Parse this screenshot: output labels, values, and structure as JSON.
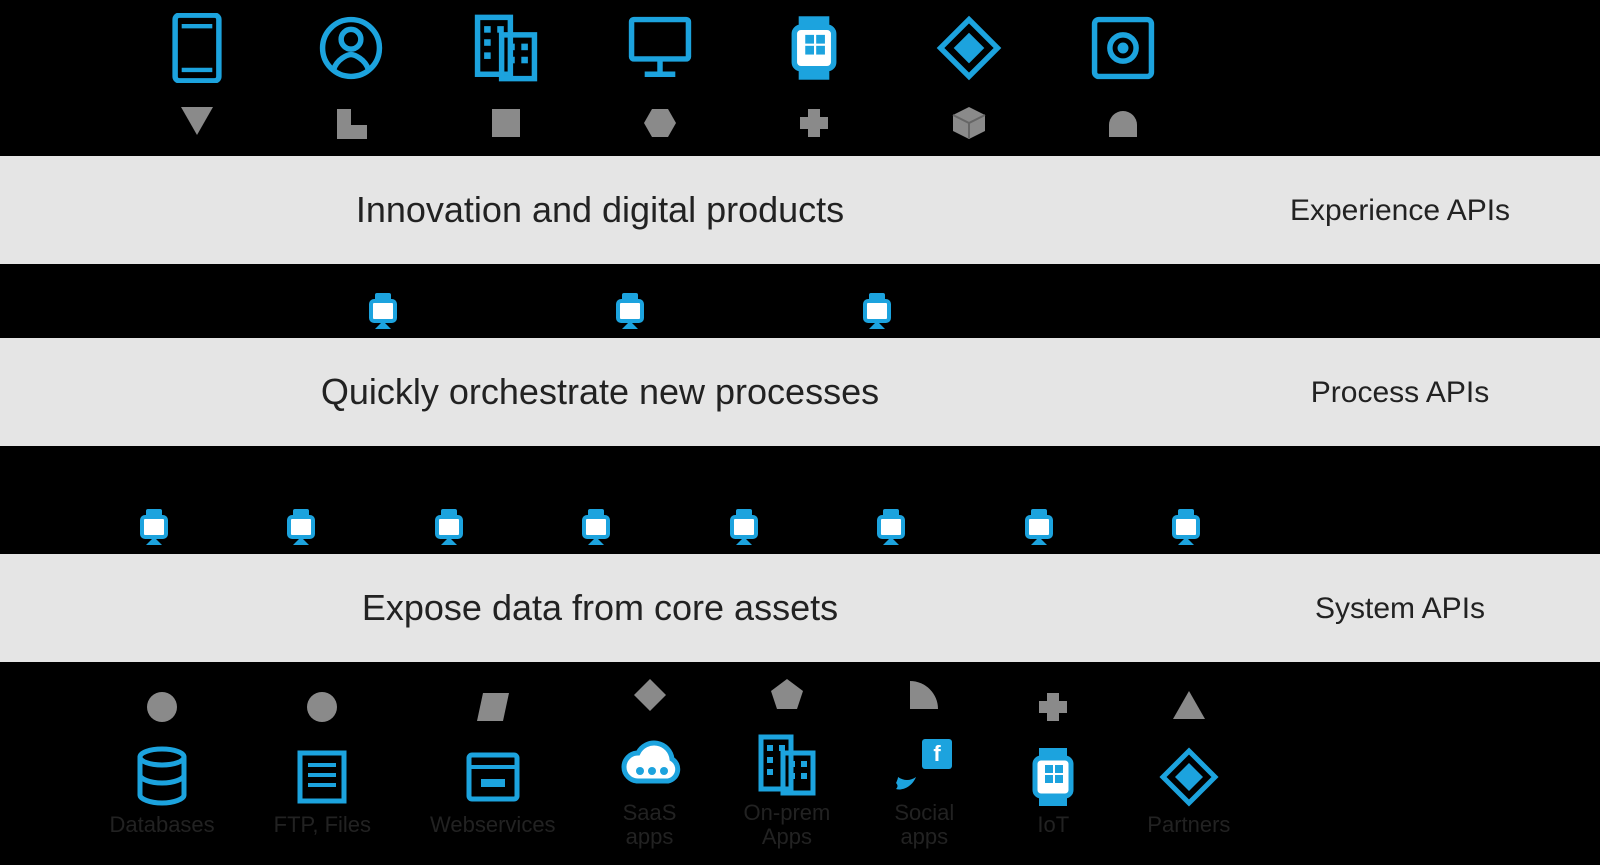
{
  "layers": {
    "experience": {
      "main": "Innovation and digital products",
      "side": "Experience\nAPIs"
    },
    "process": {
      "main": "Quickly orchestrate new processes",
      "side": "Process\nAPIs"
    },
    "system": {
      "main": "Expose data from core assets",
      "side": "System\nAPIs"
    }
  },
  "top_channels": [
    {
      "icon": "mobile",
      "shape": "triangle-down"
    },
    {
      "icon": "person",
      "shape": "l-shape"
    },
    {
      "icon": "building",
      "shape": "square"
    },
    {
      "icon": "desktop",
      "shape": "hexagon"
    },
    {
      "icon": "watch",
      "shape": "plus"
    },
    {
      "icon": "partner",
      "shape": "cube"
    },
    {
      "icon": "camera",
      "shape": "dome"
    }
  ],
  "process_markers": 3,
  "system_markers": 8,
  "bottom_assets": [
    {
      "icon": "database",
      "shape": "circle",
      "label": "Databases"
    },
    {
      "icon": "ftp",
      "shape": "circle",
      "label": "FTP, Files"
    },
    {
      "icon": "webservice",
      "shape": "skew",
      "label": "Webservices"
    },
    {
      "icon": "cloud",
      "shape": "diamond",
      "label": "SaaS\napps"
    },
    {
      "icon": "onprem",
      "shape": "pentagon",
      "label": "On-prem\nApps"
    },
    {
      "icon": "social",
      "shape": "quarter",
      "label": "Social\napps"
    },
    {
      "icon": "iot",
      "shape": "plus",
      "label": "IoT"
    },
    {
      "icon": "partner",
      "shape": "triangle-up",
      "label": "Partners"
    }
  ],
  "colors": {
    "accent": "#1ca3de",
    "shape": "#8a8a8a",
    "band": "#e5e5e5"
  }
}
